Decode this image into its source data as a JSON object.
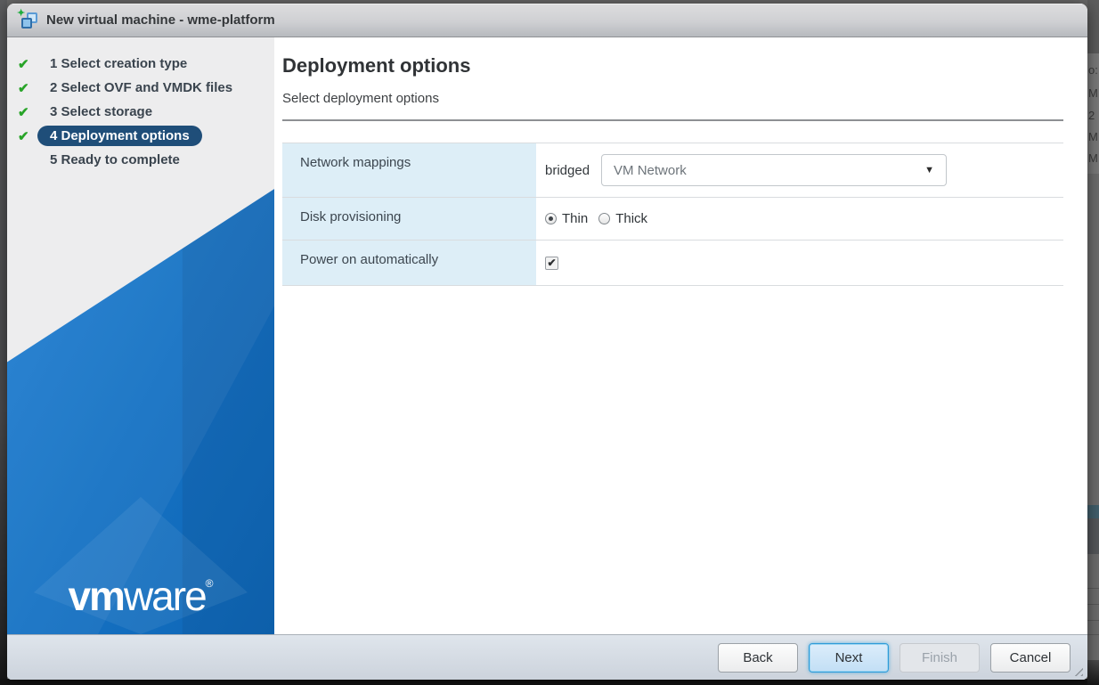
{
  "title_bar": {
    "title": "New virtual machine - wme-platform"
  },
  "icons": {
    "check": "✔",
    "new_star": "✦",
    "dropdown_arrow": "▼",
    "checkbox_check": "✔"
  },
  "steps": [
    {
      "label": "1 Select creation type",
      "completed": true,
      "active": false
    },
    {
      "label": "2 Select OVF and VMDK files",
      "completed": true,
      "active": false
    },
    {
      "label": "3 Select storage",
      "completed": true,
      "active": false
    },
    {
      "label": "4 Deployment options",
      "completed": true,
      "active": true
    },
    {
      "label": "5 Ready to complete",
      "completed": false,
      "active": false
    }
  ],
  "page": {
    "heading": "Deployment options",
    "subheading": "Select deployment options"
  },
  "form": {
    "network": {
      "label": "Network mappings",
      "source": "bridged",
      "selected": "VM Network"
    },
    "disk": {
      "label": "Disk provisioning",
      "options": [
        "Thin",
        "Thick"
      ],
      "selected": "Thin"
    },
    "power": {
      "label": "Power on automatically",
      "checked": true
    }
  },
  "footer": {
    "back": "Back",
    "next": "Next",
    "finish": "Finish",
    "cancel": "Cancel"
  },
  "branding": {
    "logo_bold": "vm",
    "logo_light": "ware",
    "registered": "®"
  },
  "background": {
    "fragments": [
      "o:",
      "M",
      "2",
      "M",
      "M"
    ]
  },
  "colors": {
    "active_step_bg": "#1f4e79",
    "check_green": "#28a428",
    "sidebar_blue": "#1571c3",
    "label_cell_bg": "#ddeef7",
    "next_button_border": "#2f9bd8",
    "footer_bg": "#d3dae2"
  }
}
